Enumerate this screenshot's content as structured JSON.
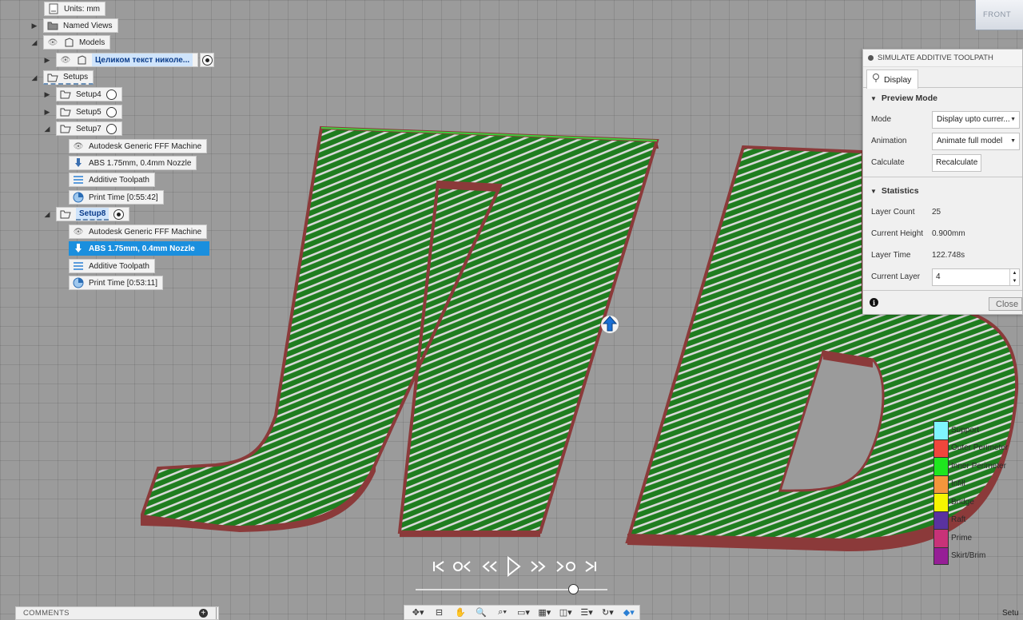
{
  "browser": {
    "units": "Units: mm",
    "named_views": "Named Views",
    "models": "Models",
    "model_component": "Целиком текст николе...",
    "setups": "Setups",
    "setup4": "Setup4",
    "setup5": "Setup5",
    "setup7": "Setup7",
    "setup7_children": {
      "machine": "Autodesk Generic FFF Machine",
      "material": "ABS 1.75mm, 0.4mm Nozzle",
      "toolpath": "Additive Toolpath",
      "print_time": "Print Time [0:55:42]"
    },
    "setup8": "Setup8",
    "setup8_children": {
      "machine": "Autodesk Generic FFF Machine",
      "material": "ABS 1.75mm, 0.4mm Nozzle",
      "toolpath": "Additive Toolpath",
      "print_time": "Print Time [0:53:11]"
    }
  },
  "panel": {
    "title": "SIMULATE ADDITIVE TOOLPATH",
    "tab": "Display",
    "preview_mode": {
      "heading": "Preview Mode",
      "mode_label": "Mode",
      "mode_value": "Display upto currer...",
      "animation_label": "Animation",
      "animation_value": "Animate full model",
      "calculate_label": "Calculate",
      "recalculate_button": "Recalculate"
    },
    "statistics": {
      "heading": "Statistics",
      "layer_count_label": "Layer Count",
      "layer_count": "25",
      "current_height_label": "Current Height",
      "current_height": "0.900mm",
      "layer_time_label": "Layer Time",
      "layer_time": "122.748s",
      "current_layer_label": "Current Layer",
      "current_layer": "4"
    },
    "close_button": "Close"
  },
  "legend": [
    {
      "label": "Support",
      "color": "#7ff5ff"
    },
    {
      "label": "Outer Perimeter",
      "color": "#f0463c"
    },
    {
      "label": "Inner Perimeter",
      "color": "#1ee61e"
    },
    {
      "label": "Infill",
      "color": "#f5963c"
    },
    {
      "label": "Bridge",
      "color": "#f5f500"
    },
    {
      "label": "Raft",
      "color": "#5a32a0"
    },
    {
      "label": "Prime",
      "color": "#c83278"
    },
    {
      "label": "Skirt/Brim",
      "color": "#961e96"
    }
  ],
  "playback": {
    "slider_fraction": 0.82
  },
  "viewcube": {
    "face": "FRONT"
  },
  "bottom": {
    "comments": "COMMENTS",
    "status": "Setu"
  },
  "colors": {
    "perimeter": "#1f8a1f",
    "outer_wall": "#8b3a3a",
    "selection": "#1a8fde"
  }
}
